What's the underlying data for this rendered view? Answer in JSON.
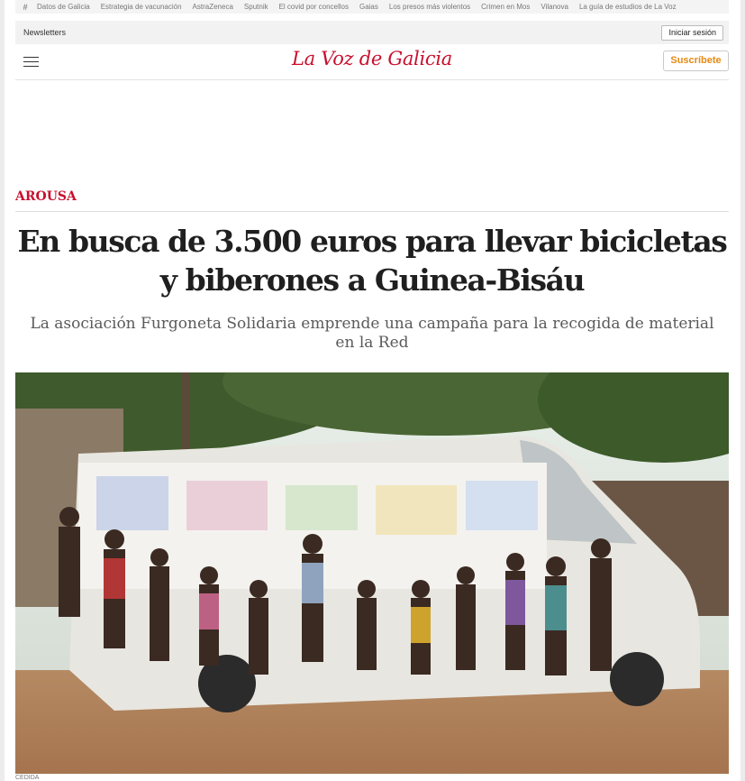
{
  "trending": {
    "items": [
      "Datos de Galicia",
      "Estrategia de vacunación",
      "AstraZeneca",
      "Sputnik",
      "El covid por concellos",
      "Gaias",
      "Los presos más violentos",
      "Crimen en Mos",
      "Vilanova",
      "La guía de estudios de La Voz"
    ]
  },
  "topbar": {
    "newsletters": "Newsletters",
    "login": "Iniciar sesión"
  },
  "header": {
    "logo": "La Voz de Galicia",
    "subscribe": "Suscríbete"
  },
  "article": {
    "section": "AROUSA",
    "headline": "En busca de 3.500 euros para llevar bicicletas y biberones a Guinea-Bisáu",
    "subhead": "La asociación Furgoneta Solidaria emprende una campaña para la recogida de material en la Red",
    "photo_credit": "CEDIDA"
  },
  "colors": {
    "brand": "#c8102e",
    "subscribe": "#e68a12"
  }
}
